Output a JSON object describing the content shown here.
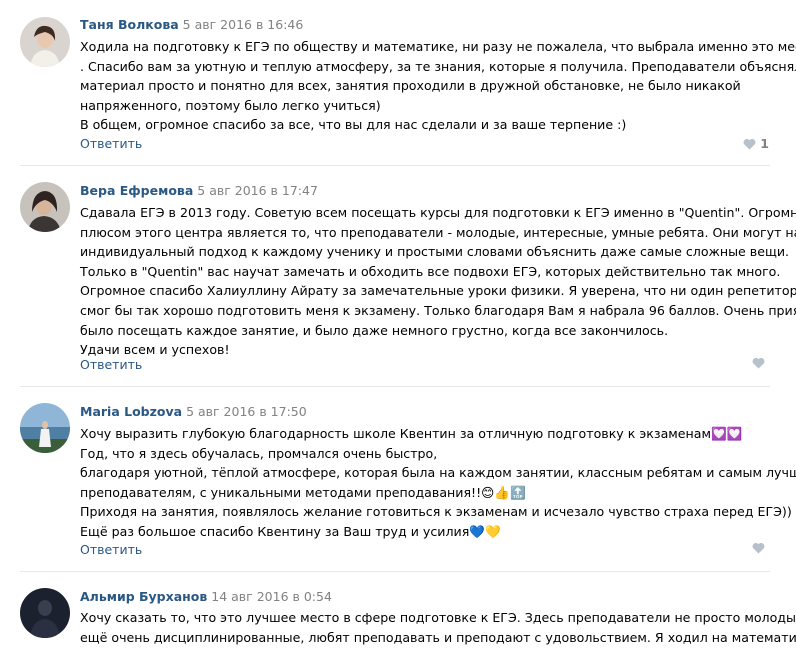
{
  "ui": {
    "reply_label": "Ответить"
  },
  "comments": [
    {
      "author": "Таня Волкова",
      "date": "5 авг 2016 в 16:46",
      "lines": [
        "Ходила на подготовку к ЕГЭ по обществу и математике, ни разу не пожалела, что выбрала именно это место",
        ". Спасибо вам за уютную и теплую атмосферу, за те знания, которые я получила. Преподаватели объясняли",
        "материал просто и понятно для всех, занятия проходили в дружной обстановке, не было никакой",
        "напряженного, поэтому было легко учиться)",
        "В общем, огромное спасибо за все, что вы для нас сделали и за ваше терпение :)"
      ],
      "likes": "1"
    },
    {
      "author": "Вера Ефремова",
      "date": "5 авг 2016 в 17:47",
      "lines": [
        "Сдавала ЕГЭ в 2013 году. Советую всем посещать курсы для подготовки к ЕГЭ именно в \"Quentin\". Огромным",
        "плюсом этого центра является то, что преподаватели - молодые, интересные, умные ребята. Они могут найти",
        "индивидуальный подход к каждому ученику и простыми словами объяснить даже самые сложные вещи.",
        "Только в \"Quentin\" вас научат замечать и обходить все подвохи ЕГЭ, которых действительно так много.",
        "Огромное спасибо Халиуллину Айрату за замечательные уроки физики. Я уверена, что ни один репетитор не",
        "смог бы так хорошо подготовить меня к экзамену. Только благодаря Вам я набрала 96 баллов. Очень приятно",
        "было посещать каждое занятие, и было даже немного грустно, когда все закончилось.",
        "Удачи всем и успехов!"
      ],
      "likes": ""
    },
    {
      "author": "Maria Lobzova",
      "date": "5 авг 2016 в 17:50",
      "lines": [
        "Хочу выразить глубокую благодарность школе Квентин за отличную подготовку к экзаменам💟💟",
        "Год, что я здесь обучалась, промчался очень быстро,",
        "благодаря уютной, тёплой атмосфере, которая была на каждом занятии, классным ребятам и самым лучшим",
        "преподавателям, с уникальными методами преподавания!!😊👍🔝",
        "Приходя на занятия, появлялось желание готовиться к экзаменам и исчезало чувство страха перед ЕГЭ))",
        "Ещё раз большое спасибо Квентину за Ваш труд и усилия💙💛"
      ],
      "likes": ""
    },
    {
      "author": "Альмир Бурханов",
      "date": "14 авг 2016 в 0:54",
      "lines": [
        "Хочу сказать то, что это лучшее место в сфере подготовке к ЕГЭ. Здесь преподаватели не просто молодые, но",
        "ещё очень дисциплинированные, любят преподавать и преподают с удовольствием. Я ходил на математику с"
      ],
      "likes": ""
    }
  ]
}
